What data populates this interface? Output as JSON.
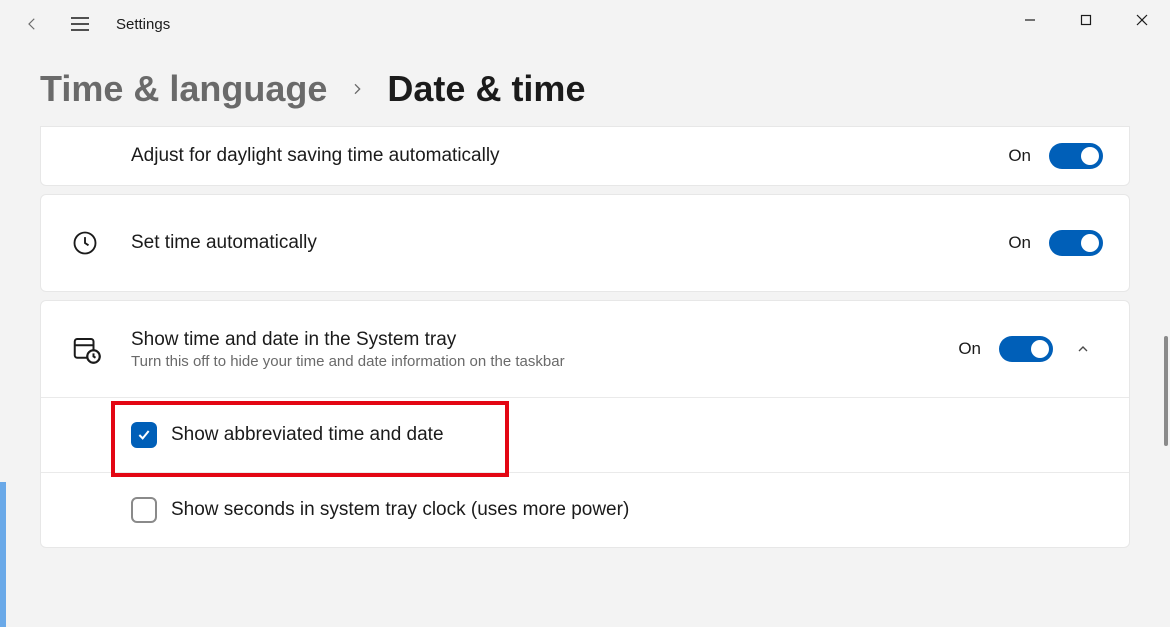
{
  "app_title": "Settings",
  "breadcrumb": {
    "parent": "Time & language",
    "current": "Date & time"
  },
  "rows": {
    "dst": {
      "label": "Adjust for daylight saving time automatically",
      "state": "On",
      "toggle_on": true
    },
    "auto_time": {
      "label": "Set time automatically",
      "state": "On",
      "toggle_on": true
    },
    "tray": {
      "label": "Show time and date in the System tray",
      "sub": "Turn this off to hide your time and date information on the taskbar",
      "state": "On",
      "toggle_on": true
    }
  },
  "checks": {
    "abbrev": {
      "label": "Show abbreviated time and date",
      "checked": true
    },
    "seconds": {
      "label": "Show seconds in system tray clock (uses more power)",
      "checked": false
    }
  },
  "colors": {
    "accent": "#005fb8",
    "highlight": "#e30613"
  }
}
